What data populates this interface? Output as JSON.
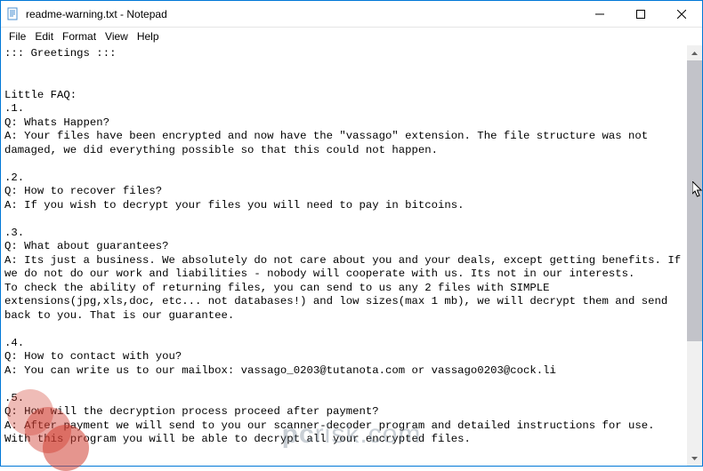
{
  "title": "readme-warning.txt - Notepad",
  "menu": {
    "file": "File",
    "edit": "Edit",
    "format": "Format",
    "view": "View",
    "help": "Help"
  },
  "body": "::: Greetings :::\n\n\nLittle FAQ:\n.1.\nQ: Whats Happen?\nA: Your files have been encrypted and now have the \"vassago\" extension. The file structure was not damaged, we did everything possible so that this could not happen.\n\n.2.\nQ: How to recover files?\nA: If you wish to decrypt your files you will need to pay in bitcoins.\n\n.3.\nQ: What about guarantees?\nA: Its just a business. We absolutely do not care about you and your deals, except getting benefits. If we do not do our work and liabilities - nobody will cooperate with us. Its not in our interests.\nTo check the ability of returning files, you can send to us any 2 files with SIMPLE extensions(jpg,xls,doc, etc... not databases!) and low sizes(max 1 mb), we will decrypt them and send back to you. That is our guarantee.\n\n.4.\nQ: How to contact with you?\nA: You can write us to our mailbox: vassago_0203@tutanota.com or vassago0203@cock.li\n\n.5.\nQ: How will the decryption process proceed after payment?\nA: After payment we will send to you our scanner-decoder program and detailed instructions for use. With this program you will be able to decrypt all your encrypted files.",
  "watermark": "pcrisk.com"
}
